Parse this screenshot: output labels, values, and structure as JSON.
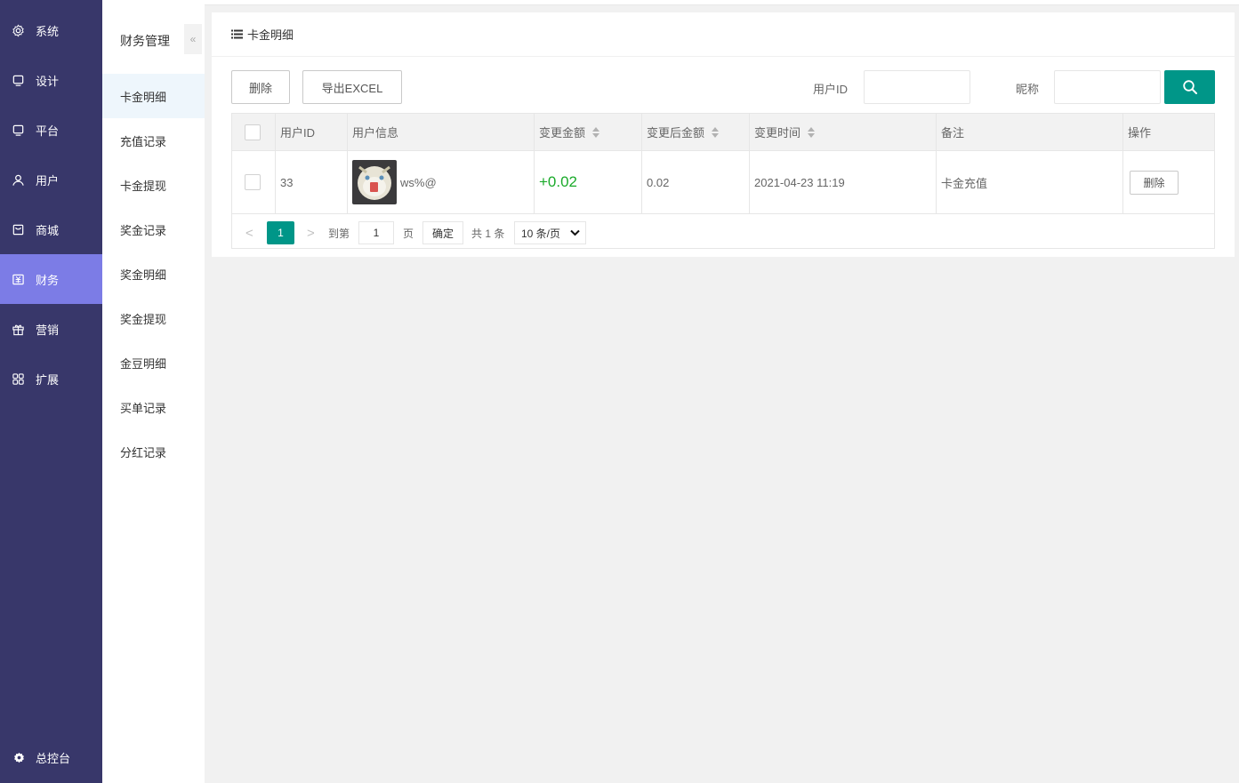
{
  "nav": {
    "items": [
      {
        "label": "系统",
        "icon": "gear-icon"
      },
      {
        "label": "设计",
        "icon": "monitor-icon"
      },
      {
        "label": "平台",
        "icon": "monitor-icon"
      },
      {
        "label": "用户",
        "icon": "user-icon"
      },
      {
        "label": "商城",
        "icon": "shop-icon"
      },
      {
        "label": "财务",
        "icon": "finance-icon",
        "active": true
      },
      {
        "label": "营销",
        "icon": "gift-icon"
      },
      {
        "label": "扩展",
        "icon": "grid-icon"
      }
    ],
    "bottom": {
      "label": "总控台",
      "icon": "gear-icon"
    }
  },
  "submenu": {
    "title": "财务管理",
    "collapse_icon": "«",
    "items": [
      "卡金明细",
      "充值记录",
      "卡金提现",
      "奖金记录",
      "奖金明细",
      "奖金提现",
      "金豆明细",
      "买单记录",
      "分红记录"
    ],
    "active_index": 0
  },
  "page": {
    "title": "卡金明细",
    "toolbar": {
      "delete_label": "删除",
      "export_label": "导出EXCEL"
    },
    "filters": {
      "user_id_label": "用户ID",
      "user_id_value": "",
      "nickname_label": "昵称",
      "nickname_value": ""
    }
  },
  "table": {
    "columns": [
      "用户ID",
      "用户信息",
      "变更金额",
      "变更后金额",
      "变更时间",
      "备注",
      "操作"
    ],
    "rows": [
      {
        "user_id": "33",
        "nickname": "ws%@",
        "change": "+0.02",
        "after": "0.02",
        "time": "2021-04-23 11:19",
        "note": "卡金充值",
        "action": "删除"
      }
    ]
  },
  "pager": {
    "prev": "<",
    "next": ">",
    "current_page": "1",
    "goto_label": "到第",
    "goto_value": "1",
    "page_unit": "页",
    "confirm_label": "确定",
    "total_text": "共 1 条",
    "page_size": "10 条/页"
  },
  "colors": {
    "nav_bg": "#38376a",
    "nav_active": "#7c7ce6",
    "accent": "#009688",
    "amount_positive": "#1aaa2a"
  }
}
